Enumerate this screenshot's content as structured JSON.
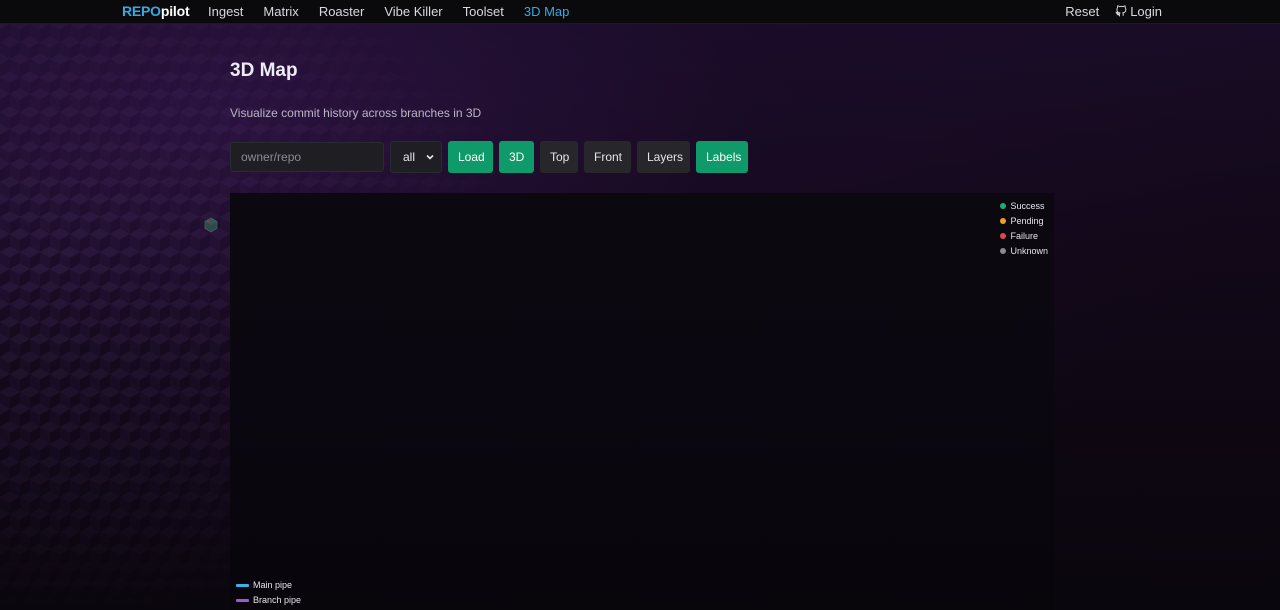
{
  "brand": {
    "part1": "REPO",
    "part2": "pilot"
  },
  "nav": {
    "links": [
      {
        "label": "Ingest",
        "active": false
      },
      {
        "label": "Matrix",
        "active": false
      },
      {
        "label": "Roaster",
        "active": false
      },
      {
        "label": "Vibe Killer",
        "active": false
      },
      {
        "label": "Toolset",
        "active": false
      },
      {
        "label": "3D Map",
        "active": true
      }
    ],
    "reset_label": "Reset",
    "login_label": "Login",
    "login_icon": "github-icon"
  },
  "page": {
    "title": "3D Map",
    "subtitle": "Visualize commit history across branches in 3D"
  },
  "controls": {
    "repo_placeholder": "owner/repo",
    "repo_value": "",
    "branch_selected": "all",
    "load_label": "Load",
    "view_3d_label": "3D",
    "view_top_label": "Top",
    "view_front_label": "Front",
    "layers_label": "Layers",
    "labels_label": "Labels"
  },
  "legend": {
    "status": [
      {
        "label": "Success",
        "color": "#18b07a"
      },
      {
        "label": "Pending",
        "color": "#f0a020"
      },
      {
        "label": "Failure",
        "color": "#e04848"
      },
      {
        "label": "Unknown",
        "color": "#8a8a92"
      }
    ],
    "pipes": [
      {
        "label": "Main pipe",
        "color": "#3ab4e8"
      },
      {
        "label": "Branch pipe",
        "color": "#9a5ad8"
      }
    ]
  },
  "colors": {
    "accent_blue": "#38a8e6",
    "button_green": "#0f9a6a",
    "button_dark": "#26262b"
  }
}
